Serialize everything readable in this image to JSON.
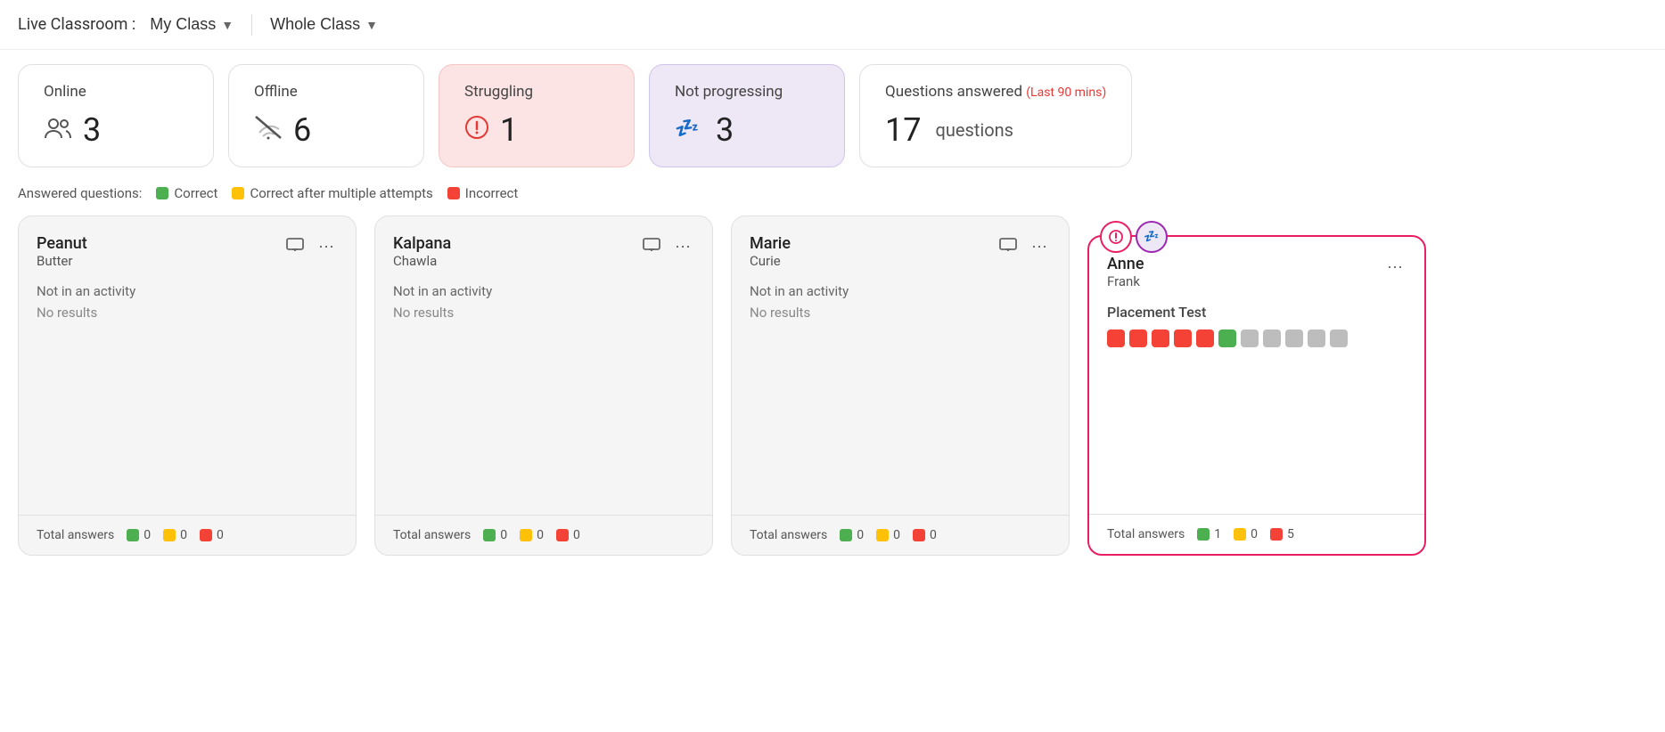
{
  "header": {
    "live_classroom_label": "Live Classroom :",
    "my_class_label": "My Class",
    "whole_class_label": "Whole Class"
  },
  "stats": [
    {
      "id": "online",
      "title": "Online",
      "value": "3",
      "icon": "👥",
      "style": "white"
    },
    {
      "id": "offline",
      "title": "Offline",
      "value": "6",
      "icon": "📶",
      "style": "white"
    },
    {
      "id": "struggling",
      "title": "Struggling",
      "value": "1",
      "icon": "⚠",
      "style": "pink"
    },
    {
      "id": "not_progressing",
      "title": "Not progressing",
      "value": "3",
      "icon": "💤",
      "style": "lavender"
    },
    {
      "id": "questions_answered",
      "title": "Questions answered",
      "subtitle": "(Last 90 mins)",
      "value": "17",
      "suffix": "questions",
      "style": "white-wide"
    }
  ],
  "legend": {
    "label": "Answered questions:",
    "items": [
      {
        "id": "correct",
        "label": "Correct",
        "color": "green"
      },
      {
        "id": "correct_multiple",
        "label": "Correct after multiple attempts",
        "color": "yellow"
      },
      {
        "id": "incorrect",
        "label": "Incorrect",
        "color": "red"
      }
    ]
  },
  "students": [
    {
      "id": "peanut",
      "firstname": "Peanut",
      "lastname": "Butter",
      "activity": "Not in an activity",
      "results": "No results",
      "highlighted": false,
      "badges": [],
      "footer": {
        "correct": 0,
        "correct_multiple": 0,
        "incorrect": 0
      }
    },
    {
      "id": "kalpana",
      "firstname": "Kalpana",
      "lastname": "Chawla",
      "activity": "Not in an activity",
      "results": "No results",
      "highlighted": false,
      "badges": [],
      "footer": {
        "correct": 0,
        "correct_multiple": 0,
        "incorrect": 0
      }
    },
    {
      "id": "marie",
      "firstname": "Marie",
      "lastname": "Curie",
      "activity": "Not in an activity",
      "results": "No results",
      "highlighted": false,
      "badges": [],
      "footer": {
        "correct": 0,
        "correct_multiple": 0,
        "incorrect": 0
      }
    },
    {
      "id": "anne",
      "firstname": "Anne",
      "lastname": "Frank",
      "activity": "Placement Test",
      "results": null,
      "highlighted": true,
      "badges": [
        "struggling",
        "not_progressing"
      ],
      "answer_dots": [
        "red",
        "red",
        "red",
        "red",
        "red",
        "green",
        "gray",
        "gray",
        "gray",
        "gray",
        "gray"
      ],
      "footer": {
        "correct": 1,
        "correct_multiple": 0,
        "incorrect": 5
      }
    }
  ],
  "labels": {
    "total_answers": "Total answers",
    "not_in_activity": "Not in an activity",
    "no_results": "No results",
    "more_options": "⋯"
  }
}
